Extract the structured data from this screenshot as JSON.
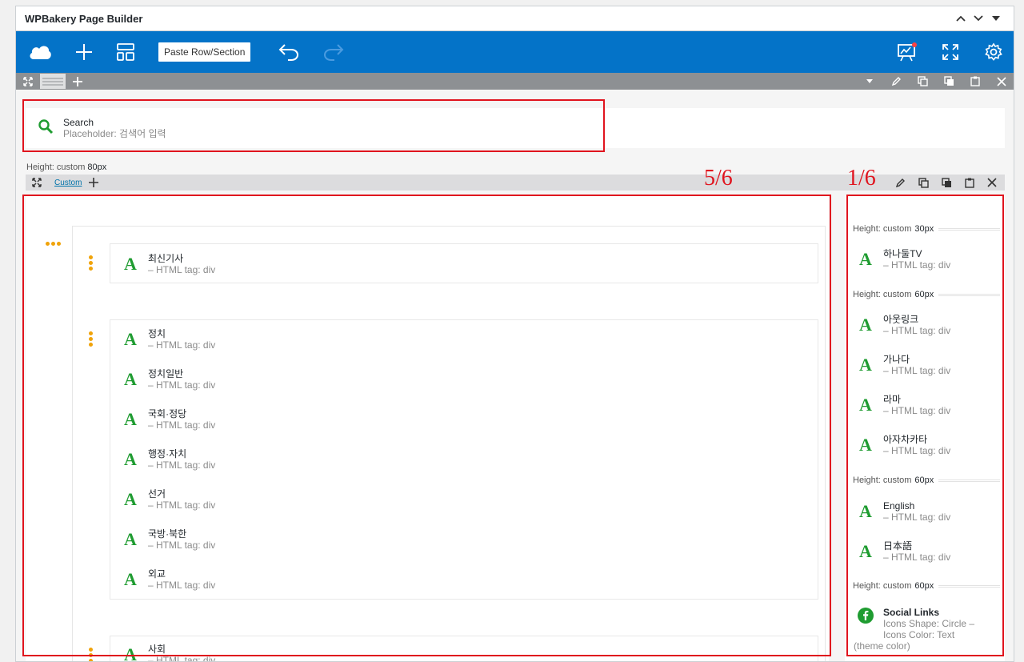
{
  "panel": {
    "title": "WPBakery Page Builder"
  },
  "navbar": {
    "paste_label": "Paste Row/Section"
  },
  "search_element": {
    "title": "Search",
    "subtitle": "Placeholder: 검색어 입력"
  },
  "row_height": {
    "label": "Height: custom",
    "value": "80px"
  },
  "inner_row": {
    "tab_label": "Custom"
  },
  "left_column": {
    "group1": [
      {
        "title": "최신기사",
        "subtitle": "– HTML tag: div"
      }
    ],
    "group2": [
      {
        "title": "정치",
        "subtitle": "– HTML tag: div"
      },
      {
        "title": "정치일반",
        "subtitle": "– HTML tag: div"
      },
      {
        "title": "국회·정당",
        "subtitle": "– HTML tag: div"
      },
      {
        "title": "행정·자치",
        "subtitle": "– HTML tag: div"
      },
      {
        "title": "선거",
        "subtitle": "– HTML tag: div"
      },
      {
        "title": "국방·북한",
        "subtitle": "– HTML tag: div"
      },
      {
        "title": "외교",
        "subtitle": "– HTML tag: div"
      }
    ],
    "group3": [
      {
        "title": "사회",
        "subtitle": "– HTML tag: div"
      }
    ]
  },
  "right_column": {
    "spacers": [
      {
        "label": "Height: custom",
        "value": "30px"
      },
      {
        "label": "Height: custom",
        "value": "60px"
      },
      {
        "label": "Height: custom",
        "value": "60px"
      },
      {
        "label": "Height: custom",
        "value": "60px"
      }
    ],
    "items": [
      {
        "title": "하나둘TV",
        "subtitle": "– HTML tag: div"
      },
      {
        "title": "아웃링크",
        "subtitle": "– HTML tag: div"
      },
      {
        "title": "가나다",
        "subtitle": "– HTML tag: div"
      },
      {
        "title": "라마",
        "subtitle": "– HTML tag: div"
      },
      {
        "title": "아자차카타",
        "subtitle": "– HTML tag: div"
      },
      {
        "title": "English",
        "subtitle": "– HTML tag: div"
      },
      {
        "title": "日本語",
        "subtitle": "– HTML tag: div"
      }
    ],
    "social": {
      "title": "Social Links",
      "line1": "Icons Shape: Circle –",
      "line2": "Icons Color: Text",
      "line3": "(theme color)"
    }
  },
  "annotations": {
    "left_label": "5/6",
    "right_label": "1/6",
    "color": "#e0141e"
  },
  "colors": {
    "navbar": "#0473c8",
    "element_icon": "#1f9c31",
    "drag_dots": "#f0a30a"
  }
}
